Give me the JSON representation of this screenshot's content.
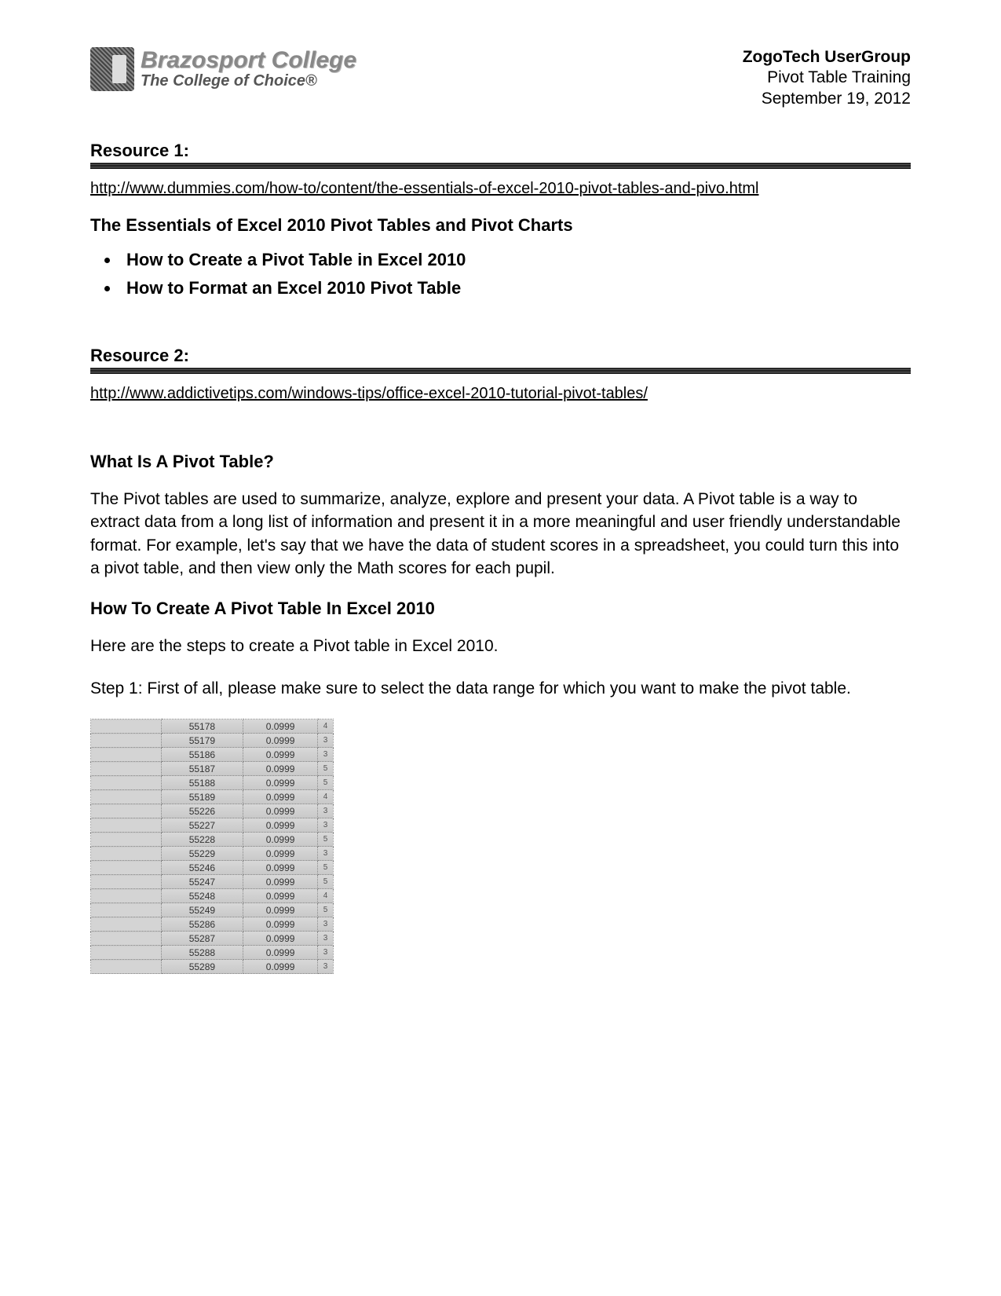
{
  "header": {
    "logo_line1": "Brazosport College",
    "logo_line2": "The College of Choice®",
    "meta_title": "ZogoTech UserGroup",
    "meta_sub": "Pivot Table Training",
    "meta_date": "September 19, 2012"
  },
  "resource1": {
    "title": "Resource 1:",
    "link": "http://www.dummies.com/how-to/content/the-essentials-of-excel-2010-pivot-tables-and-pivo.html",
    "sub": "The Essentials of Excel 2010 Pivot Tables and Pivot Charts",
    "items": [
      "How to Create a Pivot Table in Excel 2010",
      "How to Format an Excel 2010 Pivot Table"
    ]
  },
  "resource2": {
    "title": "Resource 2:",
    "link": "http://www.addictivetips.com/windows-tips/office-excel-2010-tutorial-pivot-tables/",
    "q": "What Is A Pivot Table?",
    "desc": "The Pivot tables are used to summarize, analyze, explore and present your data. A Pivot table is a way to extract data from a long list of information and present it in a more meaningful and user friendly understandable format. For example, let's say that we have the data of student scores in a spreadsheet, you could turn this into a pivot table, and then view only the Math scores for each pupil.",
    "how_title": "How To Create A Pivot Table In Excel 2010",
    "how_intro": "Here are the steps to create a Pivot table in Excel 2010.",
    "step1": "Step 1: First of all, please make sure to select the data range for which you want to make the pivot table."
  },
  "sheet_rows": [
    {
      "id": "55178",
      "v": "0.0999",
      "f": "4"
    },
    {
      "id": "55179",
      "v": "0.0999",
      "f": "3"
    },
    {
      "id": "55186",
      "v": "0.0999",
      "f": "3"
    },
    {
      "id": "55187",
      "v": "0.0999",
      "f": "5"
    },
    {
      "id": "55188",
      "v": "0.0999",
      "f": "5"
    },
    {
      "id": "55189",
      "v": "0.0999",
      "f": "4"
    },
    {
      "id": "55226",
      "v": "0.0999",
      "f": "3"
    },
    {
      "id": "55227",
      "v": "0.0999",
      "f": "3"
    },
    {
      "id": "55228",
      "v": "0.0999",
      "f": "5"
    },
    {
      "id": "55229",
      "v": "0.0999",
      "f": "3"
    },
    {
      "id": "55246",
      "v": "0.0999",
      "f": "5"
    },
    {
      "id": "55247",
      "v": "0.0999",
      "f": "5"
    },
    {
      "id": "55248",
      "v": "0.0999",
      "f": "4"
    },
    {
      "id": "55249",
      "v": "0.0999",
      "f": "5"
    },
    {
      "id": "55286",
      "v": "0.0999",
      "f": "3"
    },
    {
      "id": "55287",
      "v": "0.0999",
      "f": "3"
    },
    {
      "id": "55288",
      "v": "0.0999",
      "f": "3"
    },
    {
      "id": "55289",
      "v": "0.0999",
      "f": "3"
    }
  ]
}
